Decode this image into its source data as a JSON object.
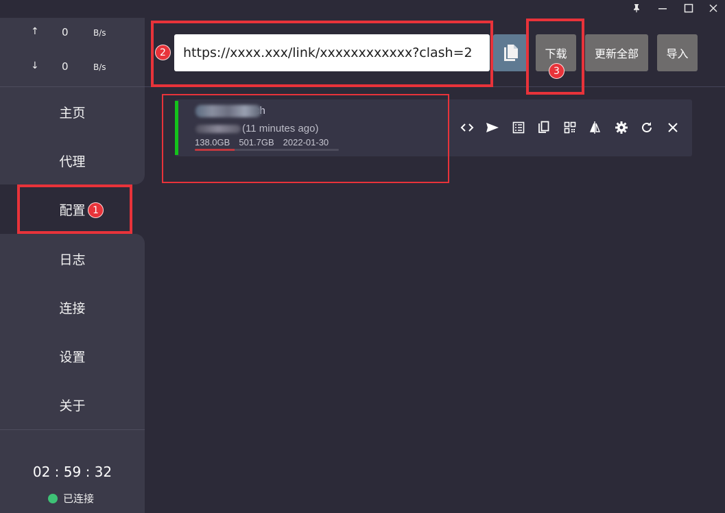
{
  "window": {
    "controls": [
      "pin",
      "minimize",
      "maximize",
      "close"
    ]
  },
  "traffic": {
    "up_arrow": "↑",
    "up_value": "0",
    "up_unit": "B/s",
    "down_arrow": "↓",
    "down_value": "0",
    "down_unit": "B/s"
  },
  "nav": {
    "items": [
      {
        "label": "主页"
      },
      {
        "label": "代理"
      },
      {
        "label": "配置"
      },
      {
        "label": "日志"
      },
      {
        "label": "连接"
      },
      {
        "label": "设置"
      },
      {
        "label": "关于"
      }
    ],
    "active": "配置"
  },
  "clock": "02 : 59 : 32",
  "connection_status": {
    "label": "已连接",
    "color": "#3ec276"
  },
  "toolbar": {
    "url_value": "https://xxxx.xxx/link/xxxxxxxxxxxx?clash=2",
    "download_label": "下载",
    "update_all_label": "更新全部",
    "import_label": "导入"
  },
  "profile": {
    "name_suffix": "ch",
    "updated": "(11 minutes ago)",
    "used": "138.0GB",
    "total": "501.7GB",
    "expire": "2022-01-30",
    "usage_fraction": 0.275,
    "active_color": "#14c21b",
    "actions": [
      "code-icon",
      "send-icon",
      "list-icon",
      "copy-icon",
      "qrcode-icon",
      "compare-icon",
      "settings-icon",
      "refresh-icon",
      "close-icon"
    ]
  },
  "annotations": {
    "badge_1": "1",
    "badge_2": "2",
    "badge_3": "3",
    "color": "#e8333a"
  }
}
